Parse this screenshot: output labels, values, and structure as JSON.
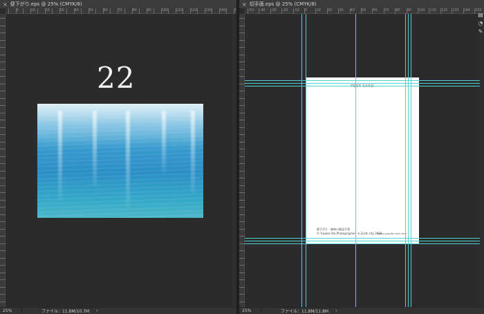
{
  "left_window": {
    "tab_title": "昼下がり.eps @ 25% (CMYK/8)",
    "close_symbol": "×",
    "ruler_h": [
      "",
      "0",
      "",
      "10",
      "",
      "20",
      "",
      "30",
      "",
      "40",
      "",
      "50",
      "",
      "60",
      "",
      "70",
      "",
      "80",
      "",
      "90",
      "",
      "100",
      "",
      "110",
      "",
      "120",
      "",
      "130",
      "",
      "140",
      "",
      "150"
    ],
    "big_number": "22",
    "zoom": "25%",
    "doc_size": "ファイル：11.8M/10.7M",
    "status_arrow": "›"
  },
  "right_window": {
    "tab_title": "切手面.eps @ 25% (CMYK/8)",
    "close_symbol": "×",
    "ruler_h": [
      "-50",
      "-40",
      "-30",
      "-20",
      "-10",
      "0",
      "10",
      "20",
      "30",
      "40",
      "50",
      "60",
      "70",
      "80",
      "90",
      "100",
      "110",
      "120",
      "130",
      "140",
      "150"
    ],
    "postcard": {
      "title": "POST CARD",
      "caption_line1": "昼下がり　神奈川県逗子湾",
      "caption_line2": "© Yusuke Ota Photographer, in Zushi city 2016",
      "url": "www.yusuke-ota.com"
    },
    "zoom": "25%",
    "doc_size": "ファイル：11.8M/11.8M",
    "status_arrow": "›"
  },
  "side_icons": [
    "layers-icon",
    "history-icon",
    "paths-icon"
  ],
  "colors": {
    "canvas_bg": "#2b2b2b",
    "guide": "#4fd2d7",
    "panel": "#3c3c3c"
  }
}
